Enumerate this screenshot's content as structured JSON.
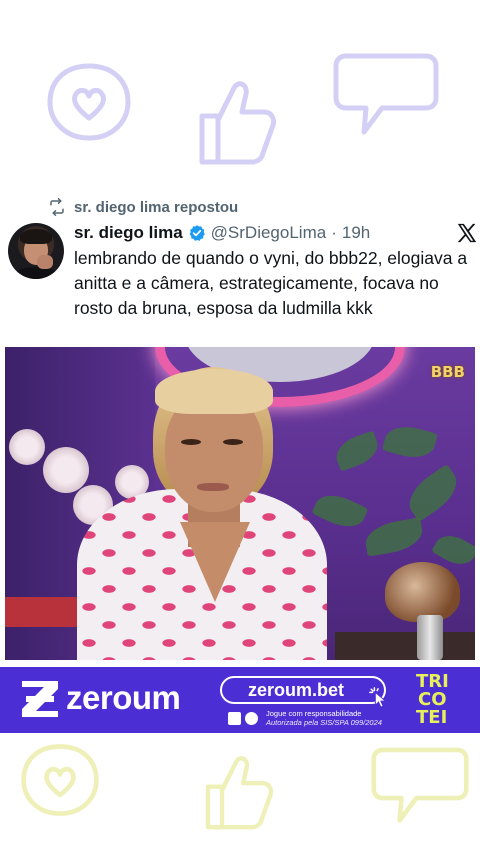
{
  "repost": {
    "icon": "repost-icon",
    "text": "sr. diego lima repostou"
  },
  "tweet": {
    "avatar": "avatar",
    "display_name": "sr. diego lima",
    "verified_icon": "verified-badge-icon",
    "handle": "@SrDiegoLima",
    "separator": "·",
    "time": "19h",
    "platform_icon": "x-logo-icon",
    "text": "lembrando de quando o vyni, do bbb22, elogiava a anitta e a câmera, estrategicamente, focava no rosto da bruna, esposa da ludmilla kkk"
  },
  "media": {
    "watermark": "BBB"
  },
  "ad": {
    "brand_logo": "zeroum-logo-icon",
    "brand": "zeroum",
    "url": "zeroum.bet",
    "cursor_icon": "cursor-click-icon",
    "legal_line1": "Jogue com responsabilidade",
    "legal_line2": "Autorizada pela SIS/SPA 099/2024",
    "tricotei": [
      "TRI",
      "CO",
      "TEI"
    ]
  },
  "colors": {
    "ad_background": "#4b2fd4",
    "tricotei_text": "#e7f05a",
    "verified": "#1d9bf0",
    "secondary_text": "#536471",
    "deco_top": "#d4cff5",
    "deco_bottom": "#eef0b8"
  }
}
